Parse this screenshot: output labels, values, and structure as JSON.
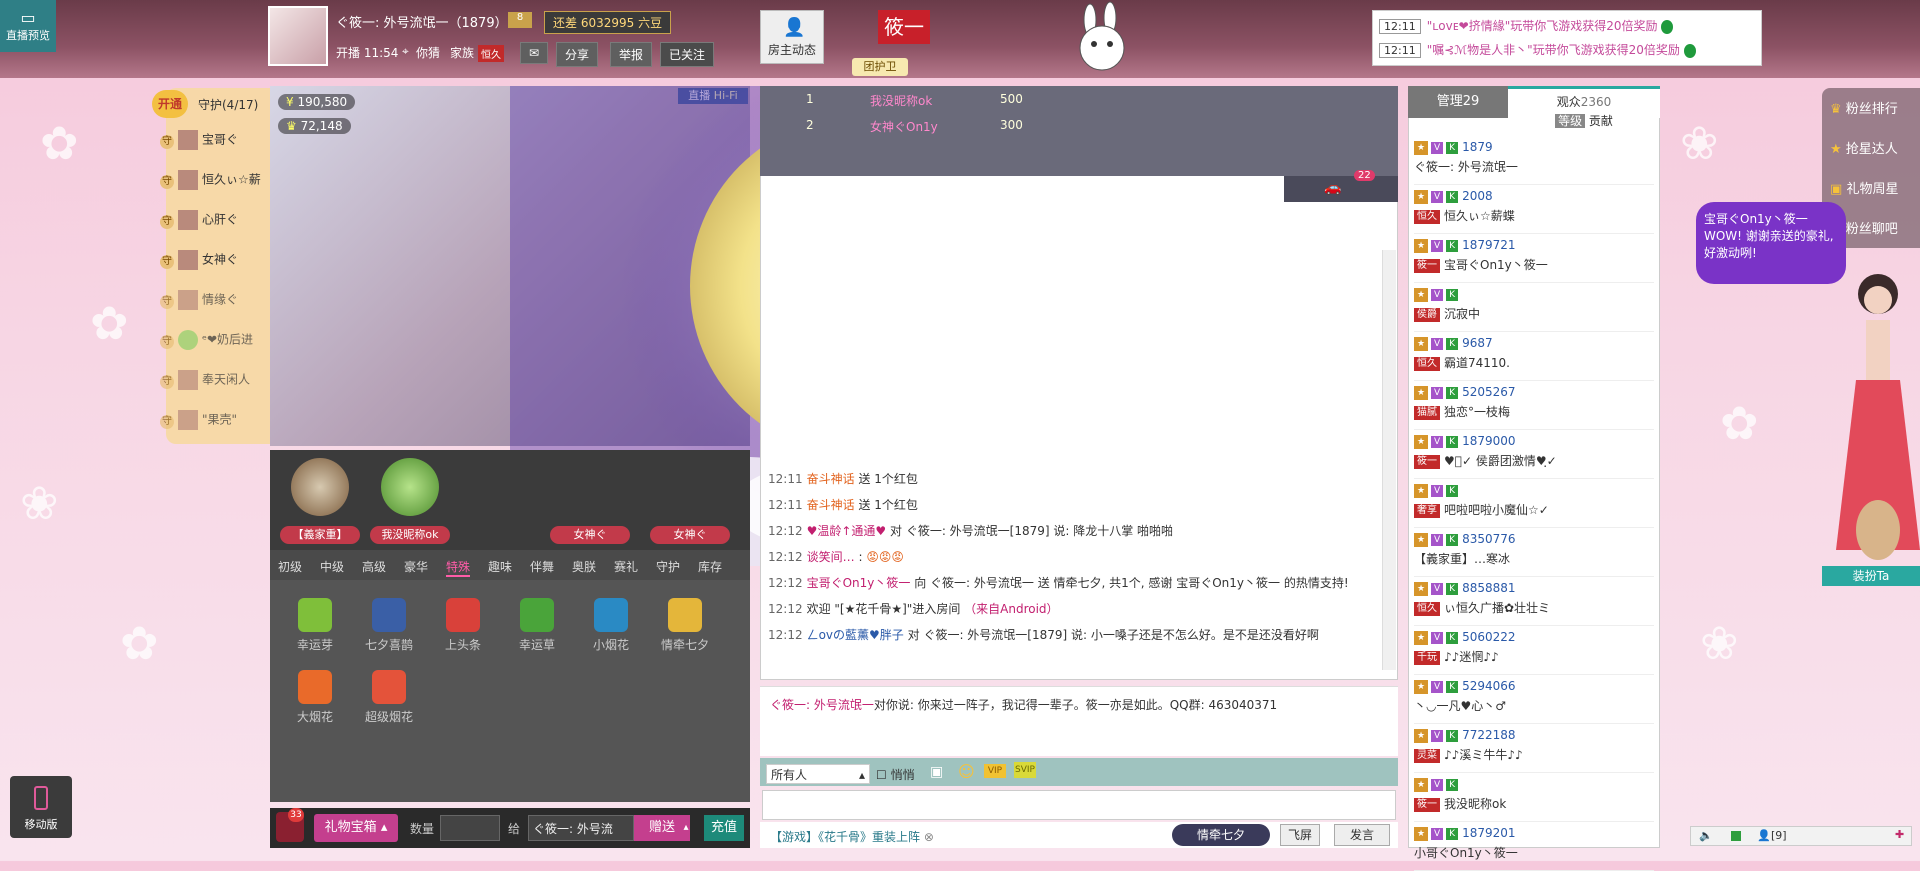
{
  "preview": {
    "label": "直播预览"
  },
  "header": {
    "host_name": "ぐ筱一: 外号流氓一（1879）",
    "gap_text": "还差 6032995 六豆",
    "start_label": "开播 11:54",
    "location": "你猜",
    "family_label": "家族",
    "family_tag": "恒久",
    "share_label": "分享",
    "report_label": "举报",
    "follow_label": "已关注",
    "host_dynamic": "房主动态",
    "flag_text": "筱一",
    "guard_tag": "团护卫"
  },
  "notices": [
    {
      "time": "12:11",
      "text": "\"ʟᴏᴠᴇ❤挤情緣\"玩带你飞游戏获得20倍奖励"
    },
    {
      "time": "12:11",
      "text": "\"嘱⊰ℳ物是人非丶\"玩带你飞游戏获得20倍奖励"
    }
  ],
  "guard": {
    "open_label": "开通",
    "title": "守护(4/17)",
    "members": [
      "宝哥ぐ",
      "恒久ぃ☆薪",
      "心肝ぐ",
      "女神ぐ",
      "情缘ぐ",
      "ᵉ❤奶后进",
      "奉天闲人",
      "\"果壳\""
    ]
  },
  "video": {
    "wealth": "190,580",
    "fans": "72,148",
    "live_label": "直播",
    "quality_label": "Hi-Fi"
  },
  "top_gifters": [
    {
      "label": "【義家重】"
    },
    {
      "label": "我没昵称ok"
    },
    {
      "label": ""
    },
    {
      "label": "女神ぐ"
    },
    {
      "label": "女神ぐ"
    }
  ],
  "gift_tabs": [
    "初级",
    "中级",
    "高级",
    "豪华",
    "特殊",
    "趣味",
    "伴舞",
    "奥朕",
    "赛礼",
    "守护",
    "库存"
  ],
  "gift_active": "特殊",
  "gifts": [
    {
      "name": "幸运芽",
      "color": "#7fbf3a"
    },
    {
      "name": "七夕喜鹊",
      "color": "#3a5fa6"
    },
    {
      "name": "上头条",
      "color": "#d9413a"
    },
    {
      "name": "幸运草",
      "color": "#4aa43a"
    },
    {
      "name": "小烟花",
      "color": "#2a8ac4"
    },
    {
      "name": "情牵七夕",
      "color": "#e4b63a"
    },
    {
      "name": "大烟花",
      "color": "#e96a2a"
    },
    {
      "name": "超级烟花",
      "color": "#e4533a"
    }
  ],
  "gift_bar": {
    "box_label": "礼物宝箱",
    "qty_label": "数量",
    "give_label": "给",
    "target": "ぐ筱一: 外号流",
    "send_label": "赠送",
    "recharge_label": "充值",
    "bag_count": "33"
  },
  "rank": [
    {
      "rank": "1",
      "name": "我没昵称ok",
      "score": "500"
    },
    {
      "rank": "2",
      "name": "女神ぐOn1y",
      "score": "300"
    }
  ],
  "car_count": "22",
  "chat": [
    {
      "time": "12:11",
      "user": "奋斗神话",
      "text": "送 1个红包"
    },
    {
      "time": "12:11",
      "user": "奋斗神话",
      "text": "送 1个红包"
    },
    {
      "time": "12:12",
      "user": "♥温龄↑通通♥",
      "text": "对 ぐ筱一: 外号流氓一[1879] 说: 降龙十八掌 啪啪啪"
    },
    {
      "time": "12:12",
      "user": "谈笑间…",
      "text": ":"
    },
    {
      "time": "12:12",
      "user": "宝哥ぐOn1y丶筱一",
      "text": "向 ぐ筱一: 外号流氓一 送 情牵七夕, 共1个, 感谢 宝哥ぐOn1y丶筱一 的热情支持!"
    },
    {
      "time": "12:12",
      "user": "欢迎 \"[★花千骨★]\"进入房间",
      "text": "（来自Android）"
    },
    {
      "time": "12:12",
      "user": "ㄥovの藍薰♥胖子",
      "text": "对 ぐ筱一: 外号流氓一[1879] 说: 小一嗓子还是不怎么好。是不是还没看好啊"
    }
  ],
  "announcement": {
    "host": "ぐ筱一: 外号流氓一",
    "text": "对你说: 你来过一阵子，我记得一辈子。筱一亦是如此。QQ群: 463040371"
  },
  "chat_tools": {
    "to_label": "所有人",
    "whisper_label": "悄悄"
  },
  "chat_foot": {
    "game_text": "【游戏】《花千骨》重装上阵",
    "qixi_label": "情牵七夕",
    "fly_label": "飞屏",
    "post_label": "发言"
  },
  "viewers": {
    "tab_mgr": "管理29",
    "tab_aud_label": "观众",
    "tab_aud_count": "2360",
    "sub_level": "等级",
    "sub_contrib": "贡献",
    "list": [
      {
        "id": "1879",
        "tag": "",
        "name": "ぐ筱一: 外号流氓一"
      },
      {
        "id": "2008",
        "tag": "恒久",
        "name": "恒久ぃ☆薪蝶"
      },
      {
        "id": "1879721",
        "tag": "筱一",
        "name": "宝哥ぐOn1y丶筱一"
      },
      {
        "id": "",
        "tag": "侯爵",
        "name": "沉寂中"
      },
      {
        "id": "9687",
        "tag": "恒久",
        "name": "霸道74110."
      },
      {
        "id": "5205267",
        "tag": "猫腻",
        "name": "独恋°一枝梅"
      },
      {
        "id": "1879000",
        "tag": "筱一",
        "name": "♥ฺ✓ 侯爵团激情♥ฺ✓"
      },
      {
        "id": "",
        "tag": "奢享",
        "name": "吧啦吧啦小魔仙☆✓"
      },
      {
        "id": "8350776",
        "tag": "",
        "name": "【義家重】…寒冰"
      },
      {
        "id": "8858881",
        "tag": "恒久",
        "name": "ぃ恒久广播✿壮壮ミ"
      },
      {
        "id": "5060222",
        "tag": "千玩",
        "name": "♪♪迷惘♪♪"
      },
      {
        "id": "5294066",
        "tag": "",
        "name": "丶◡一凡♥心丶♂"
      },
      {
        "id": "7722188",
        "tag": "灵菜",
        "name": "♪♪溪ミ牛牛♪♪"
      },
      {
        "id": "",
        "tag": "筱一",
        "name": "我没昵称ok"
      },
      {
        "id": "1879201",
        "tag": "",
        "name": "小哥ぐOn1y丶筱一"
      }
    ]
  },
  "side": {
    "items": [
      "粉丝排行",
      "抢星达人",
      "礼物周星",
      "粉丝聊吧"
    ],
    "speech": "宝哥ぐOn1y丶筱一 WOW! 谢谢亲送的豪礼, 好激动咧!",
    "dress_label": "装扮Ta"
  },
  "mobile_label": "移动版",
  "mini_bar": {
    "count": "[9]"
  }
}
